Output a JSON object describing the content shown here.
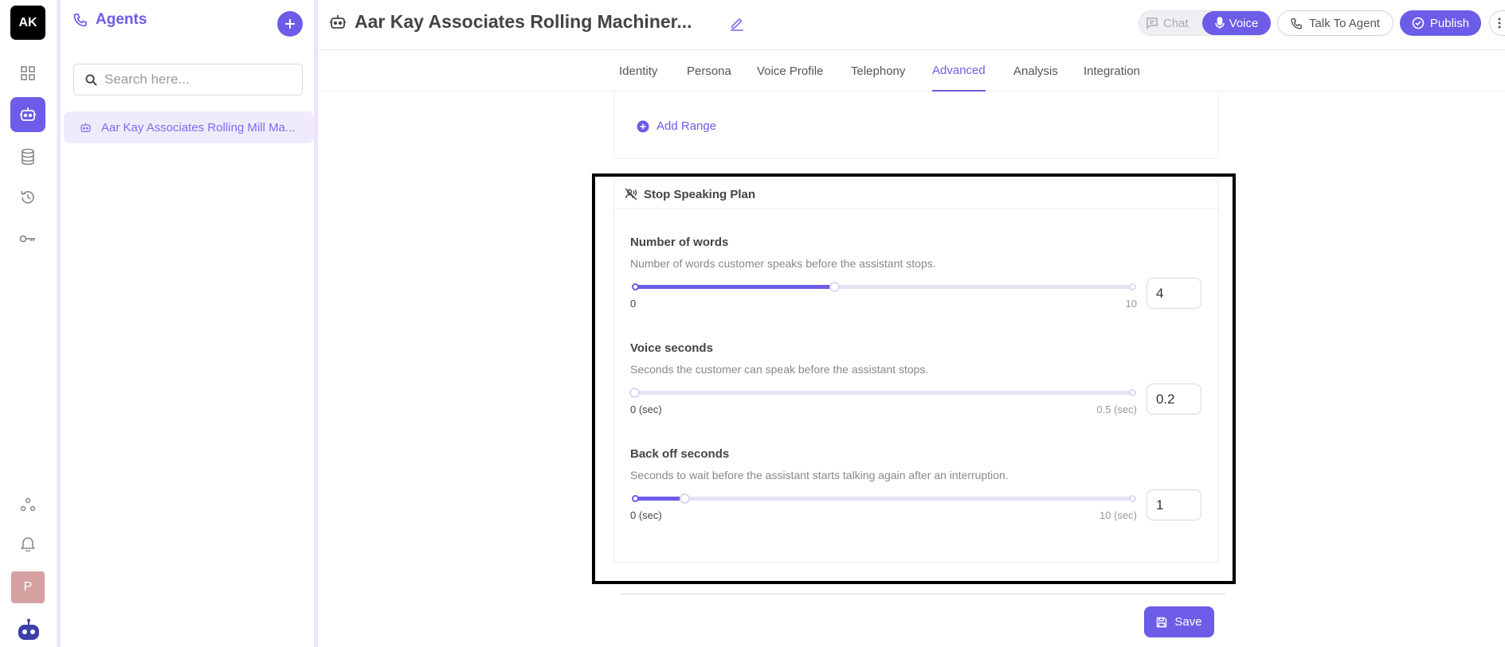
{
  "rail": {
    "logo": "AK",
    "avatar": "P",
    "items": [
      "dashboard-icon",
      "agents-icon",
      "database-icon",
      "history-icon",
      "key-icon"
    ],
    "bottom_items": [
      "integrations-icon",
      "notifications-icon"
    ]
  },
  "panel": {
    "title": "Agents",
    "search_placeholder": "Search here...",
    "agent_item": "Aar Kay Associates Rolling Mill Ma..."
  },
  "header": {
    "title": "Aar Kay Associates Rolling Machiner...",
    "chat_label": "Chat",
    "voice_label": "Voice",
    "talk_label": "Talk To Agent",
    "publish_label": "Publish"
  },
  "tabs": [
    {
      "label": "Identity"
    },
    {
      "label": "Persona"
    },
    {
      "label": "Voice Profile"
    },
    {
      "label": "Telephony"
    },
    {
      "label": "Advanced",
      "active": true
    },
    {
      "label": "Analysis"
    },
    {
      "label": "Integration"
    }
  ],
  "add_range_label": "Add Range",
  "stop_speaking": {
    "title": "Stop Speaking Plan",
    "fields": [
      {
        "label": "Number of words",
        "description": "Number of words customer speaks before the assistant stops.",
        "min_label": "0",
        "max_label": "10",
        "value": "4",
        "fraction": 0.4
      },
      {
        "label": "Voice seconds",
        "description": "Seconds the customer can speak before the assistant stops.",
        "min_label": "0 (sec)",
        "max_label": "0.5 (sec)",
        "value": "0.2",
        "fraction": 0.0
      },
      {
        "label": "Back off seconds",
        "description": "Seconds to wait before the assistant starts talking again after an interruption.",
        "min_label": "0 (sec)",
        "max_label": "10 (sec)",
        "value": "1",
        "fraction": 0.1
      }
    ]
  },
  "save_label": "Save",
  "colors": {
    "accent": "#6c5ce7",
    "accent_light": "#f0ebfc"
  }
}
